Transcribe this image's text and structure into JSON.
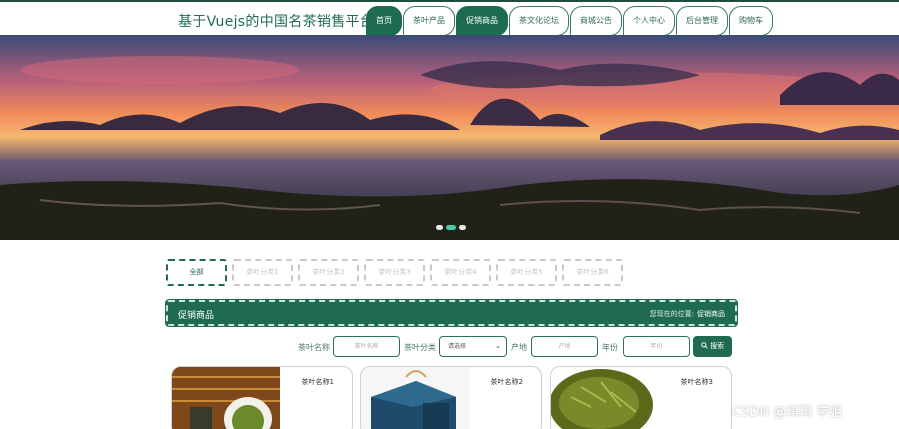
{
  "header": {
    "title": "基于Vuejs的中国名茶销售平台",
    "nav": [
      {
        "label": "首页",
        "active": true
      },
      {
        "label": "茶叶产品",
        "active": false
      },
      {
        "label": "促销商品",
        "active": true
      },
      {
        "label": "茶文化论坛",
        "active": false
      },
      {
        "label": "商城公告",
        "active": false
      },
      {
        "label": "个人中心",
        "active": false
      },
      {
        "label": "后台管理",
        "active": false
      },
      {
        "label": "购物车",
        "active": false
      }
    ]
  },
  "categories": [
    {
      "label": "全部",
      "active": true
    },
    {
      "label": "茶叶分类1",
      "active": false
    },
    {
      "label": "茶叶分类2",
      "active": false
    },
    {
      "label": "茶叶分类3",
      "active": false
    },
    {
      "label": "茶叶分类4",
      "active": false
    },
    {
      "label": "茶叶分类5",
      "active": false
    },
    {
      "label": "茶叶分类6",
      "active": false
    }
  ],
  "section": {
    "title": "促销商品",
    "location_label": "您现在的位置:",
    "location_value": "促销商品"
  },
  "search": {
    "name_label": "茶叶名称",
    "name_placeholder": "茶叶名称",
    "category_label": "茶叶分类",
    "category_value": "请选择",
    "origin_label": "产地",
    "origin_placeholder": "产地",
    "year_label": "年份",
    "year_placeholder": "年份",
    "button_label": "搜索"
  },
  "products": [
    {
      "name": "茶叶名称1"
    },
    {
      "name": "茶叶名称2"
    },
    {
      "name": "茶叶名称3"
    }
  ],
  "watermark": "CSDN @琪琪 学姐",
  "colors": {
    "brand": "#1f6b51",
    "carousel_active": "#4ec7a6"
  }
}
